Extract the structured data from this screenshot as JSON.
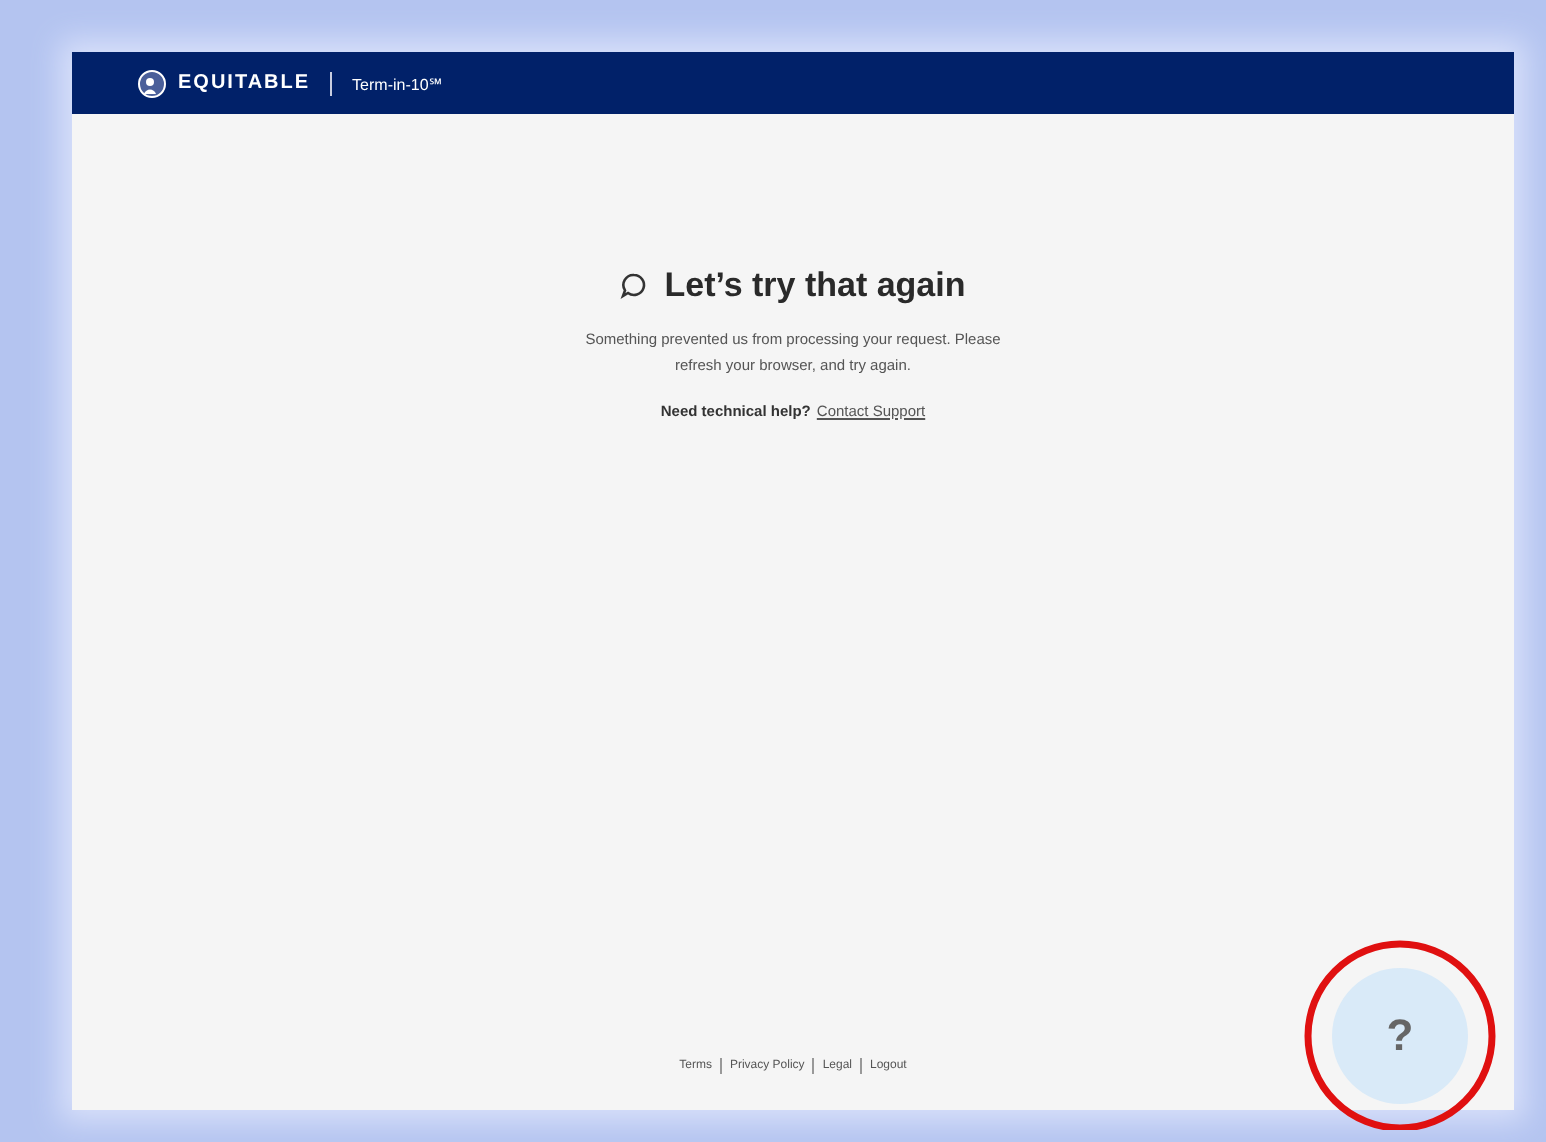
{
  "header": {
    "brand": "EQUITABLE",
    "product": "Term-in-10℠"
  },
  "message": {
    "title": "Let’s try that again",
    "body": "Something prevented us from processing your request. Please refresh your browser, and try again.",
    "help_prompt": "Need technical help?",
    "help_link": "Contact Support"
  },
  "footer_links": [
    "Terms",
    "Privacy Policy",
    "Legal",
    "Logout"
  ],
  "help_button": {
    "label": "?"
  }
}
